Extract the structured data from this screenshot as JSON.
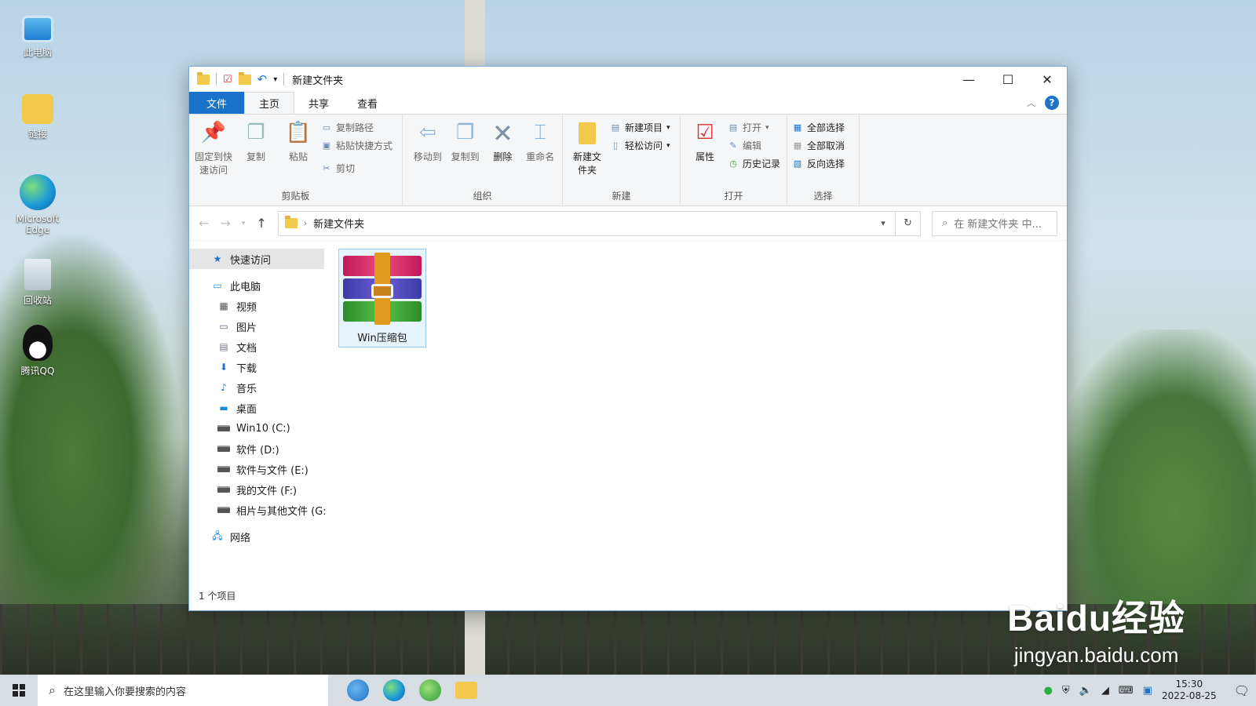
{
  "desktop": {
    "icons": [
      {
        "label": "此电脑"
      },
      {
        "label": "链接"
      },
      {
        "label": "Microsoft Edge"
      },
      {
        "label": "回收站"
      },
      {
        "label": "腾讯QQ"
      }
    ]
  },
  "window": {
    "title": "新建文件夹",
    "tabs": [
      "文件",
      "主页",
      "共享",
      "查看"
    ],
    "ribbon": {
      "clipboard": {
        "label": "剪贴板",
        "pin": "固定到快速访问",
        "copy": "复制",
        "paste": "粘贴",
        "copy_path": "复制路径",
        "paste_shortcut": "粘贴快捷方式",
        "cut": "剪切"
      },
      "organize": {
        "label": "组织",
        "move_to": "移动到",
        "copy_to": "复制到",
        "delete": "删除",
        "rename": "重命名"
      },
      "new": {
        "label": "新建",
        "new_folder": "新建文件夹",
        "new_item": "新建项目",
        "easy_access": "轻松访问"
      },
      "open": {
        "label": "打开",
        "properties": "属性",
        "open": "打开",
        "edit": "编辑",
        "history": "历史记录"
      },
      "select": {
        "label": "选择",
        "select_all": "全部选择",
        "select_none": "全部取消",
        "invert": "反向选择"
      }
    },
    "address": {
      "path": "新建文件夹",
      "search_placeholder": "在 新建文件夹 中..."
    },
    "nav_pane": {
      "quick_access": "快速访问",
      "this_pc": "此电脑",
      "items": [
        "视频",
        "图片",
        "文档",
        "下载",
        "音乐",
        "桌面"
      ],
      "drives": [
        "Win10 (C:)",
        "软件 (D:)",
        "软件与文件 (E:)",
        "我的文件 (F:)",
        "相片与其他文件 (G:"
      ],
      "network": "网络"
    },
    "files": [
      {
        "name": "Win压缩包"
      }
    ],
    "status": "1 个项目"
  },
  "watermark": {
    "brand": "Baidu经验",
    "url": "jingyan.baidu.com"
  },
  "taskbar": {
    "search_placeholder": "在这里输入你要搜索的内容",
    "time": "15:30",
    "date": "2022-08-25"
  }
}
